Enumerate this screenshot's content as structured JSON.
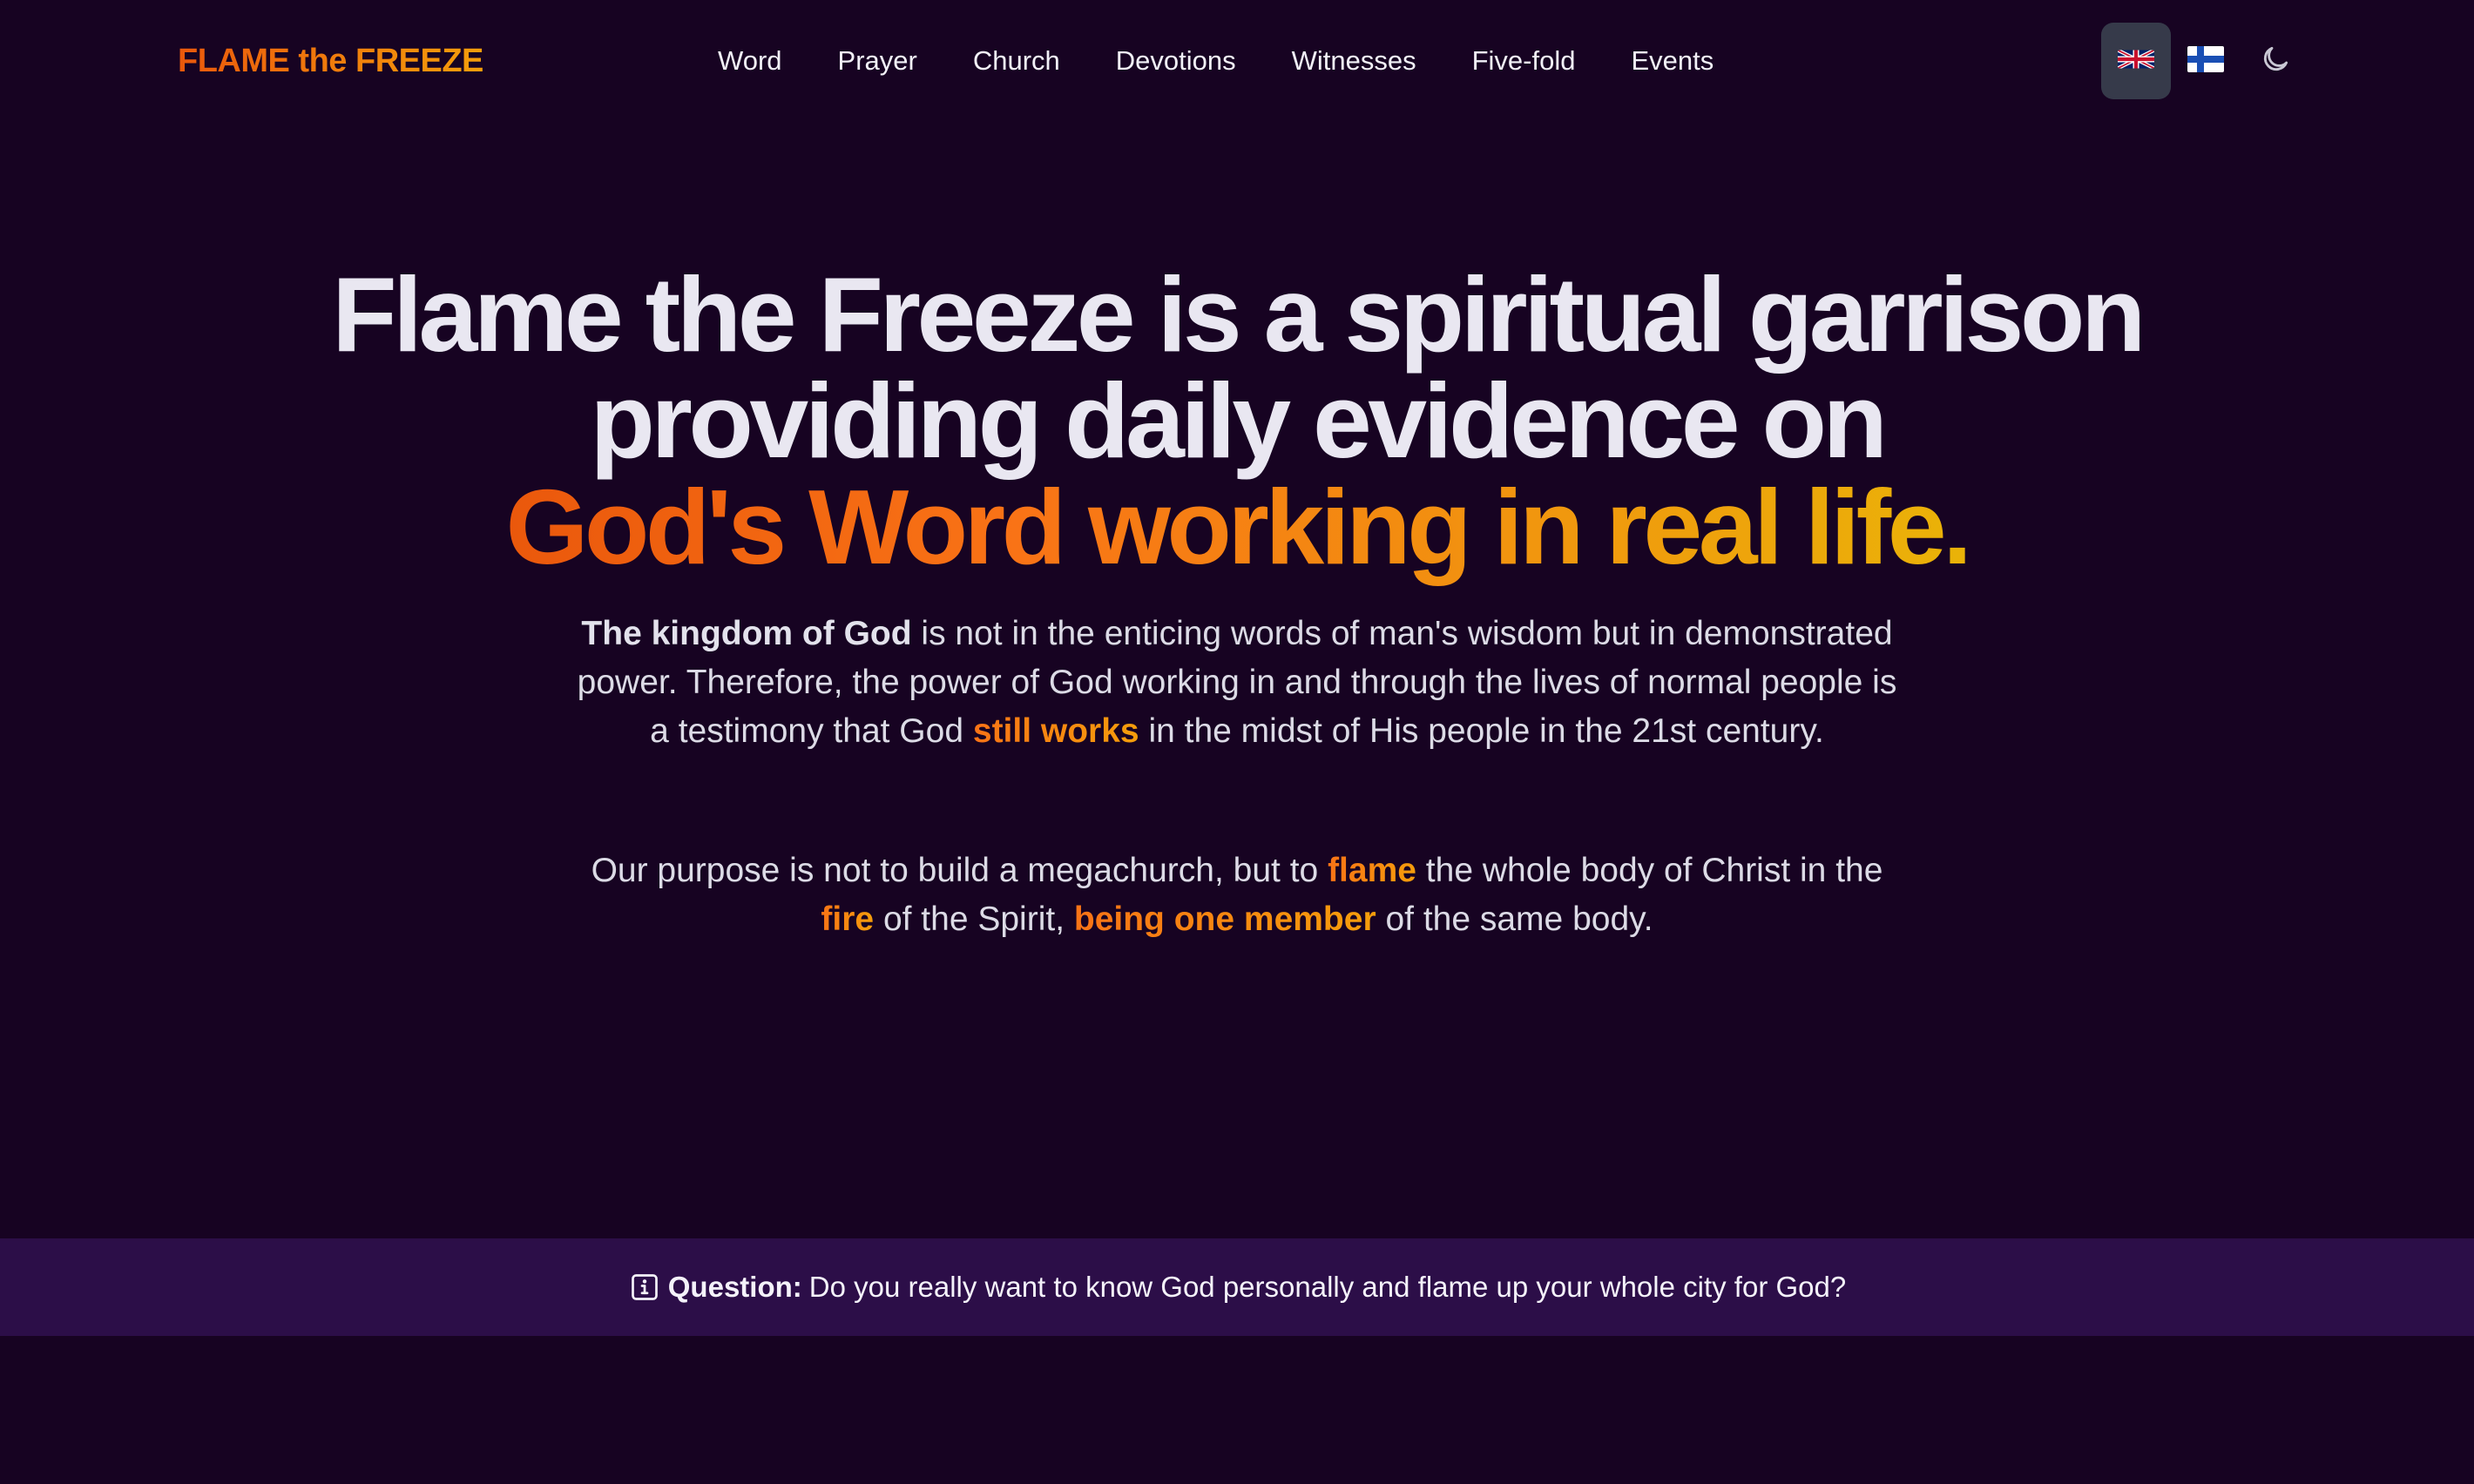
{
  "nav": {
    "logo": "FLAME the FREEZE",
    "items": [
      "Word",
      "Prayer",
      "Church",
      "Devotions",
      "Witnesses",
      "Five-fold",
      "Events"
    ],
    "languages": [
      {
        "code": "en",
        "icon": "uk-flag-icon",
        "active": true
      },
      {
        "code": "fi",
        "icon": "finland-flag-icon",
        "active": false
      }
    ],
    "theme_icon": "moon-icon"
  },
  "hero": {
    "title_line1": "Flame the Freeze is a spiritual garrison",
    "title_line2": "providing daily evidence on",
    "title_accent": "God's Word working in real life.",
    "lead1": {
      "strong": "The kingdom of God",
      "text1": " is not in the enticing words of man's wisdom but in demonstrated power. Therefore, the power of God working in and through the lives of normal people is a testimony that God ",
      "highlight": "still works",
      "text2": " in the midst of His people in the 21st century."
    },
    "lead2": {
      "text1": "Our purpose is not to build a megachurch, but to ",
      "hl1": "flame",
      "text2": " the whole body of Christ in the ",
      "hl2": "fire",
      "text3": " of the Spirit, ",
      "hl3": "being one member",
      "text4": " of the same body."
    }
  },
  "banner": {
    "icon": "info-icon",
    "label": "Question:",
    "text": "Do you really want to know God personally and flame up your whole city for God?"
  },
  "colors": {
    "background": "#170322",
    "banner_bg": "#2c0e48",
    "accent_orange": "#f97316",
    "accent_yellow": "#eab308",
    "active_lang_bg": "#363a4a"
  }
}
